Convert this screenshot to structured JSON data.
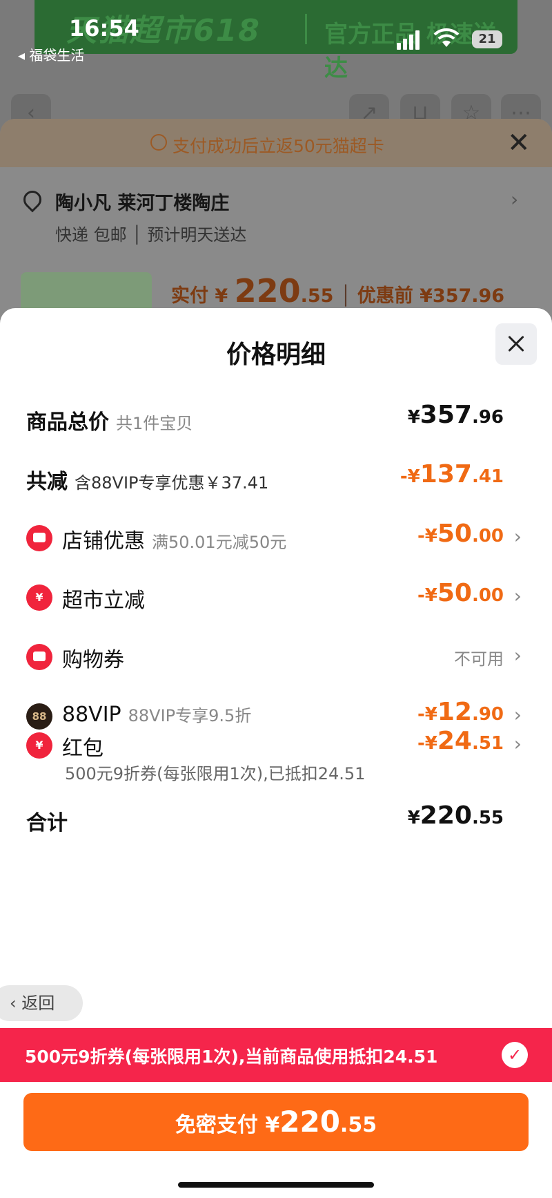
{
  "status_bar": {
    "time": "16:54",
    "back_app": "◂ 福袋生活",
    "battery": "21"
  },
  "banner": {
    "left_text": "天猫超市618",
    "right_text": "官方正品 极速送达"
  },
  "order_sheet": {
    "promo_text": "支付成功后立返50元猫超卡",
    "address_name": "陶小凡 莱河丁楼陶庄",
    "delivery_text": "快递 包邮 │ 预计明天送达",
    "paid_label": "实付 ¥ ",
    "paid_int": "220",
    "paid_dec": ".55",
    "before_label": "优惠前 ¥357.96"
  },
  "price_detail": {
    "title": "价格明细",
    "total": {
      "label": "商品总价",
      "sub": "共1件宝贝",
      "yen": "¥",
      "int": "357",
      "dec": ".96"
    },
    "reduce": {
      "label": "共减",
      "sub": "含88VIP专享优惠￥37.41",
      "yen": "-¥",
      "int": "137",
      "dec": ".41"
    },
    "shop": {
      "label": "店铺优惠",
      "sub": "满50.01元减50元",
      "yen": "-¥",
      "int": "50",
      "dec": ".00"
    },
    "market": {
      "label": "超市立减",
      "yen": "-¥",
      "int": "50",
      "dec": ".00"
    },
    "coupon": {
      "label": "购物券",
      "status": "不可用"
    },
    "vip": {
      "label": "88VIP",
      "badge": "88",
      "sub": "88VIP专享9.5折",
      "yen": "-¥",
      "int": "12",
      "dec": ".90"
    },
    "hongbao": {
      "label": "红包",
      "yen": "-¥",
      "int": "24",
      "dec": ".51",
      "note": "500元9折券(每张限用1次),已抵扣24.51"
    },
    "sum": {
      "label": "合计",
      "yen": "¥",
      "int": "220",
      "dec": ".55"
    }
  },
  "back_button": "返回",
  "coupon_bar": {
    "text": "500元9折券(每张限用1次),当前商品使用抵扣24.51"
  },
  "pay_button": {
    "label": "免密支付 ¥",
    "int": "220",
    "dec": ".55"
  },
  "colors": {
    "orange": "#fe6a16",
    "red": "#f5254b",
    "discount": "#f06a14"
  }
}
